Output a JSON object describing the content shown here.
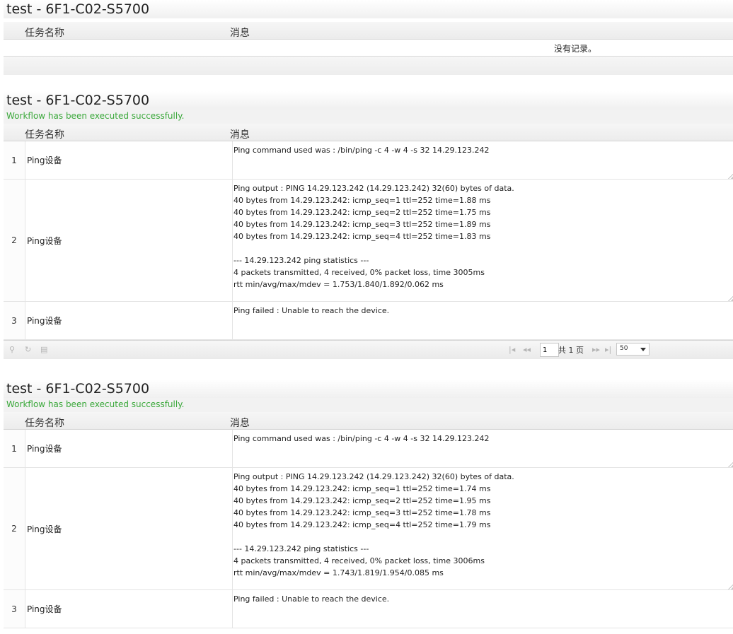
{
  "panels": [
    {
      "title": "test - 6F1-C02-S5700",
      "columns": [
        "任务名称",
        "消息"
      ],
      "empty_text": "没有记录。"
    },
    {
      "title": "test - 6F1-C02-S5700",
      "status": "Workflow has been executed successfully.",
      "columns": [
        "任务名称",
        "消息"
      ],
      "rows": [
        {
          "num": "1",
          "name": "Ping设备",
          "message": "Ping command used was : /bin/ping -c 4 -w 4 -s 32 14.29.123.242"
        },
        {
          "num": "2",
          "name": "Ping设备",
          "message": "Ping output : PING 14.29.123.242 (14.29.123.242) 32(60) bytes of data.\n40 bytes from 14.29.123.242: icmp_seq=1 ttl=252 time=1.88 ms\n40 bytes from 14.29.123.242: icmp_seq=2 ttl=252 time=1.75 ms\n40 bytes from 14.29.123.242: icmp_seq=3 ttl=252 time=1.89 ms\n40 bytes from 14.29.123.242: icmp_seq=4 ttl=252 time=1.83 ms\n\n--- 14.29.123.242 ping statistics ---\n4 packets transmitted, 4 received, 0% packet loss, time 3005ms\nrtt min/avg/max/mdev = 1.753/1.840/1.892/0.062 ms"
        },
        {
          "num": "3",
          "name": "Ping设备",
          "message": "Ping failed : Unable to reach the device."
        }
      ],
      "pager": {
        "page": "1",
        "total": "共 1 页",
        "page_size": "50"
      }
    },
    {
      "title": "test - 6F1-C02-S5700",
      "status": "Workflow has been executed successfully.",
      "columns": [
        "任务名称",
        "消息"
      ],
      "rows": [
        {
          "num": "1",
          "name": "Ping设备",
          "message": "Ping command used was : /bin/ping -c 4 -w 4 -s 32 14.29.123.242"
        },
        {
          "num": "2",
          "name": "Ping设备",
          "message": "Ping output : PING 14.29.123.242 (14.29.123.242) 32(60) bytes of data.\n40 bytes from 14.29.123.242: icmp_seq=1 ttl=252 time=1.74 ms\n40 bytes from 14.29.123.242: icmp_seq=2 ttl=252 time=1.95 ms\n40 bytes from 14.29.123.242: icmp_seq=3 ttl=252 time=1.78 ms\n40 bytes from 14.29.123.242: icmp_seq=4 ttl=252 time=1.79 ms\n\n--- 14.29.123.242 ping statistics ---\n4 packets transmitted, 4 received, 0% packet loss, time 3006ms\nrtt min/avg/max/mdev = 1.743/1.819/1.954/0.085 ms"
        },
        {
          "num": "3",
          "name": "Ping设备",
          "message": "Ping failed : Unable to reach the device."
        }
      ]
    }
  ]
}
